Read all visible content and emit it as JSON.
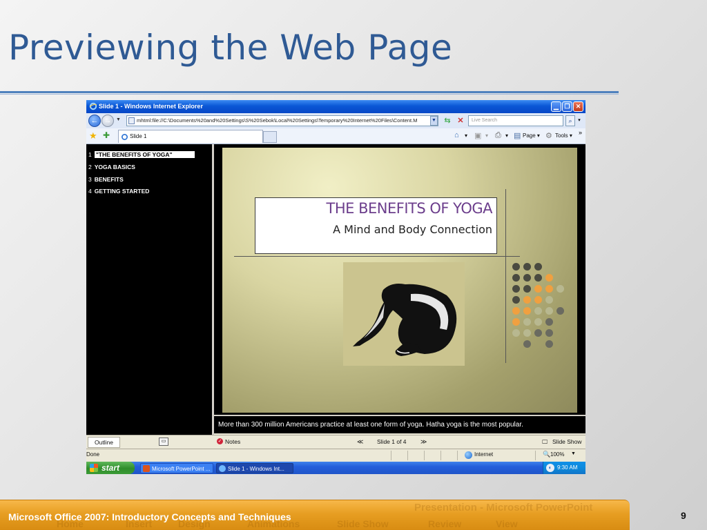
{
  "slide": {
    "title": "Previewing the Web Page",
    "footer": "Microsoft Office 2007: Introductory Concepts and Techniques",
    "page_number": "9",
    "footer_ghost": [
      "Presentation - Microsoft PowerPoint",
      "Home",
      "Insert",
      "Design",
      "Animations",
      "Slide Show",
      "Review",
      "View"
    ]
  },
  "browser": {
    "window_title": "Slide 1 - Windows Internet Explorer",
    "address": "mhtml:file://C:\\Documents%20and%20Settings\\S%20Sebok\\Local%20Settings\\Temporary%20Internet%20Files\\Content.M",
    "search_placeholder": "Live Search",
    "tab_label": "Slide 1",
    "page_menu": "Page",
    "tools_menu": "Tools",
    "status_left": "Done",
    "zone": "Internet",
    "zoom": "100%"
  },
  "outline": {
    "items": [
      {
        "num": "1",
        "label": "\"THE BENEFITS OF YOGA\"",
        "selected": true
      },
      {
        "num": "2",
        "label": "YOGA BASICS",
        "selected": false
      },
      {
        "num": "3",
        "label": "BENEFITS",
        "selected": false
      },
      {
        "num": "4",
        "label": "GETTING STARTED",
        "selected": false
      }
    ]
  },
  "presentation": {
    "slide_title": "THE BENEFITS OF YOGA",
    "slide_subtitle": "A Mind and Body Connection",
    "notes": "More than 300 million Americans practice at least one form of yoga. Hatha yoga is the most popular.",
    "accent_color": "#6c3e8c"
  },
  "viewer_bar": {
    "outline_tab": "Outline",
    "notes_label": "Notes",
    "prev_icon": "rewind-icon",
    "slide_counter": "Slide 1 of 4",
    "next_icon": "forward-icon",
    "slideshow_label": "Slide Show"
  },
  "taskbar": {
    "start_label": "start",
    "items": [
      "Microsoft PowerPoint ...",
      "Slide 1 - Windows Int..."
    ],
    "clock": "9:30 AM"
  }
}
